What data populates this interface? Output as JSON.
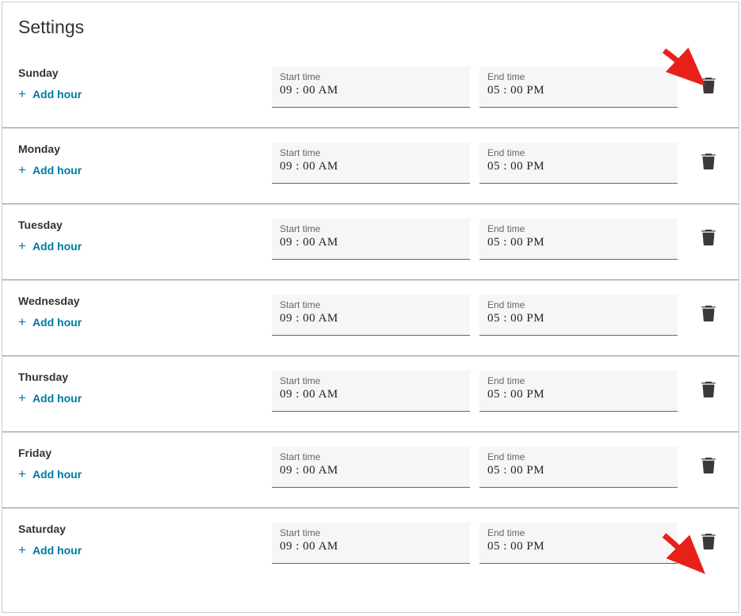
{
  "page_title": "Settings",
  "add_hour_label": "Add hour",
  "start_time_label": "Start time",
  "end_time_label": "End time",
  "days": [
    {
      "name": "Sunday",
      "start": "09 : 00  AM",
      "end": "05 : 00  PM"
    },
    {
      "name": "Monday",
      "start": "09 : 00  AM",
      "end": "05 : 00  PM"
    },
    {
      "name": "Tuesday",
      "start": "09 : 00  AM",
      "end": "05 : 00  PM"
    },
    {
      "name": "Wednesday",
      "start": "09 : 00  AM",
      "end": "05 : 00  PM"
    },
    {
      "name": "Thursday",
      "start": "09 : 00  AM",
      "end": "05 : 00  PM"
    },
    {
      "name": "Friday",
      "start": "09 : 00  AM",
      "end": "05 : 00  PM"
    },
    {
      "name": "Saturday",
      "start": "09 : 00  AM",
      "end": "05 : 00  PM"
    }
  ]
}
